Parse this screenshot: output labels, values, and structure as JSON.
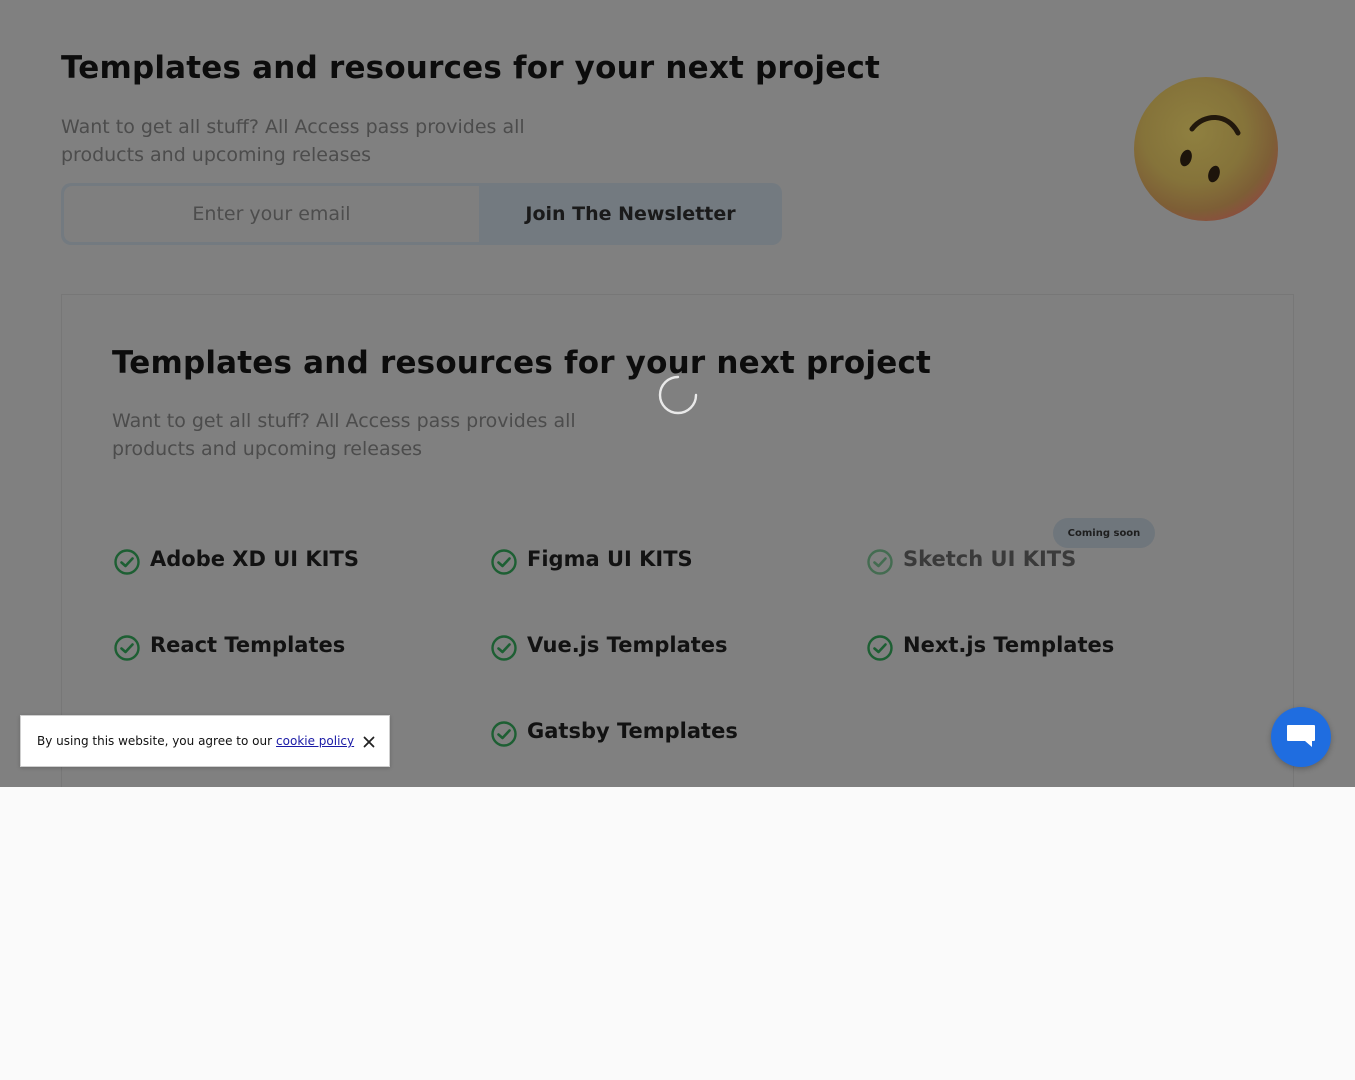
{
  "hero": {
    "title": "Templates and resources for your next project",
    "subtitle": "Want to get all stuff? All Access pass provides all products and upcoming releases",
    "email_placeholder": "Enter your email",
    "join_label": "Join The Newsletter"
  },
  "features_card": {
    "title": "Templates and resources for your next project",
    "subtitle": "Want to get all stuff? All Access pass provides all products and upcoming releases",
    "items": [
      {
        "label": "Adobe XD UI KITS"
      },
      {
        "label": "Figma UI KITS"
      },
      {
        "label": "Sketch UI KITS",
        "badge": "Coming soon"
      },
      {
        "label": "React Templates"
      },
      {
        "label": "Vue.js Templates"
      },
      {
        "label": "Next.js Templates"
      },
      {
        "label": "Gatsby Templates"
      }
    ]
  },
  "cookie_banner": {
    "text": "By using this website, you agree to our",
    "link": "cookie policy"
  },
  "icons": {
    "emoji": "upside-down-face-icon",
    "check": "check-circle-icon",
    "close": "close-icon",
    "chat": "chat-icon",
    "loading": "loading-spinner-icon"
  },
  "colors": {
    "overlay": "#808080",
    "check_green": "#1d5f33",
    "chat_blue": "#1f6de0",
    "link_blue": "#1a1aa6",
    "page_background": "#fafafa"
  }
}
